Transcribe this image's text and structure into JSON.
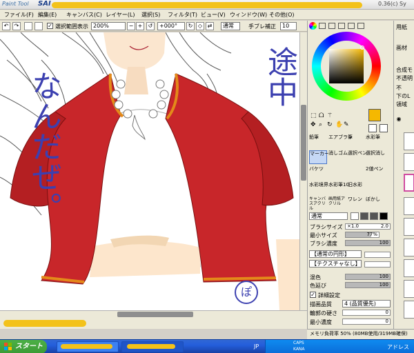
{
  "title": {
    "logo_text": "Paint Tool",
    "app_name": "SAI",
    "version": "0.36(c) Sy"
  },
  "menu": [
    "ファイル(F)",
    "編集(E)",
    "キャンバス(C)",
    "レイヤー(L)",
    "選択(S)",
    "フィルタ(T)",
    "ビュー(V)",
    "ウィンドウ(W)",
    "その他(O)"
  ],
  "toolbar": {
    "show_selection_label": "選択範囲表示",
    "zoom_value": "200%",
    "rotation_value": "+000°",
    "blend_mode": "通常",
    "stabilizer_label": "手ブレ補正",
    "stabilizer_value": "10"
  },
  "canvas": {
    "handwriting": {
      "top_right": "途中",
      "left_column": "なんだぜ。",
      "bottom_signature": "ぽ"
    }
  },
  "tools": [
    {
      "label": "鉛筆"
    },
    {
      "label": "エアブラシ"
    },
    {
      "label": "筆"
    },
    {
      "label": "水彩筆"
    },
    {
      "label": "マーカー",
      "selected": true
    },
    {
      "label": "消しゴム"
    },
    {
      "label": "選択ペン"
    },
    {
      "label": "選択消し"
    },
    {
      "label": "バケツ"
    },
    {
      "label": ""
    },
    {
      "label": ""
    },
    {
      "label": "2値ペン"
    },
    {
      "label": "水彩境界"
    },
    {
      "label": "水彩筆10"
    },
    {
      "label": "旧水彩"
    },
    {
      "label": ""
    },
    {
      "label": "キャンバスアクリル"
    },
    {
      "label": "画用紙アクリル"
    },
    {
      "label": "ワレン"
    },
    {
      "label": "ぼかし"
    }
  ],
  "brush": {
    "mode": "通常",
    "size_label": "ブラシサイズ",
    "size_multiplier": "×1.0",
    "size_value": "2.0",
    "min_size_label": "最小サイズ",
    "min_size_value": "77%",
    "density_label": "ブラシ濃度",
    "density_value": "100",
    "shape_value": "【通常の円形】",
    "texture_value": "【テクスチャなし】",
    "mix_label": "混色",
    "mix_value": "100",
    "extend_label": "色延び",
    "extend_value": "100",
    "detail_label": "詳細設定",
    "quality_label": "描画品質",
    "quality_value": "4 (品質優先)",
    "edge_label": "輪郭の硬さ",
    "edge_value": "0",
    "min_density_label": "最小濃度",
    "min_density_value": "0"
  },
  "colors": {
    "primary": "#f5b800",
    "canvas_bg": "#ffffff",
    "jacket": "#c8262a"
  },
  "far_panel": {
    "label1": "用紙",
    "label2": "画材",
    "label3": "合成モ",
    "label4": "不透明",
    "label5": "不",
    "label6": "下のL",
    "label7": "領域"
  },
  "status": {
    "memory_text": "メモリ負荷率 50% (80MB使用/319MB確保)"
  },
  "taskbar": {
    "start_label": "スタート",
    "lang": "JP",
    "caps": "CAPS",
    "kana": "KANA",
    "tray_text": "アドレス"
  }
}
